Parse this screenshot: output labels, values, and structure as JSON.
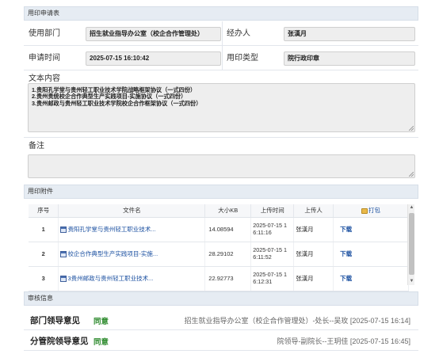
{
  "sections": {
    "application": "用印申请表",
    "attachments": "用印附件",
    "review": "审核信息"
  },
  "form": {
    "department_label": "使用部门",
    "department_value": "招生就业指导办公室（校企合作管理处）",
    "handler_label": "经办人",
    "handler_value": "张漢月",
    "apply_time_label": "申请时间",
    "apply_time_value": "2025-07-15 16:10:42",
    "seal_type_label": "用印类型",
    "seal_type_value": "院行政印章",
    "content_label": "文本内容",
    "content_lines": [
      "1.贵阳孔学堂与贵州轻工职业技术学院战略框架协议（一式四份）",
      "2.贵州贵统校企合作典型生产实践项目-实施协议（一式四份）",
      "3.贵州邮政与贵州轻工职业技术学院校企合作框架协议（一式四份）"
    ],
    "remarks_label": "备注",
    "remarks_value": ""
  },
  "attachments_table": {
    "headers": [
      "序号",
      "文件名",
      "大小KB",
      "上传时间",
      "上传人",
      "打包"
    ],
    "rows": [
      {
        "index": "1",
        "name": "贵阳孔学堂与贵州轻工职业技术...",
        "size": "14.08594",
        "time_line1": "2025-07-15 1",
        "time_line2": "6:11:16",
        "uploader": "张漢月",
        "action": "下载"
      },
      {
        "index": "2",
        "name": "校企合作典型生产实践项目-实施...",
        "size": "28.29102",
        "time_line1": "2025-07-15 1",
        "time_line2": "6:11:52",
        "uploader": "张漢月",
        "action": "下载"
      },
      {
        "index": "3",
        "name": "3贵州邮政与贵州轻工职业技术...",
        "size": "22.92773",
        "time_line1": "2025-07-15 1",
        "time_line2": "6:12:31",
        "uploader": "张漢月",
        "action": "下载"
      }
    ]
  },
  "review": [
    {
      "role": "部门领导意见",
      "status": "同意",
      "detail": "招生就业指导办公室（校企合作管理处）-处长--吴玫 [2025-07-15 16:14]"
    },
    {
      "role": "分管院领导意见",
      "status": "同意",
      "detail": "院领导-副院长--王玥佳 [2025-07-15 16:45]"
    }
  ],
  "icons": {
    "file": "document-icon",
    "print": "printer-icon",
    "resize": "resize-grip-icon"
  },
  "colors": {
    "link": "#1a4fa0",
    "approve": "#2e8b2e",
    "header_bg": "#e6ecf3"
  }
}
